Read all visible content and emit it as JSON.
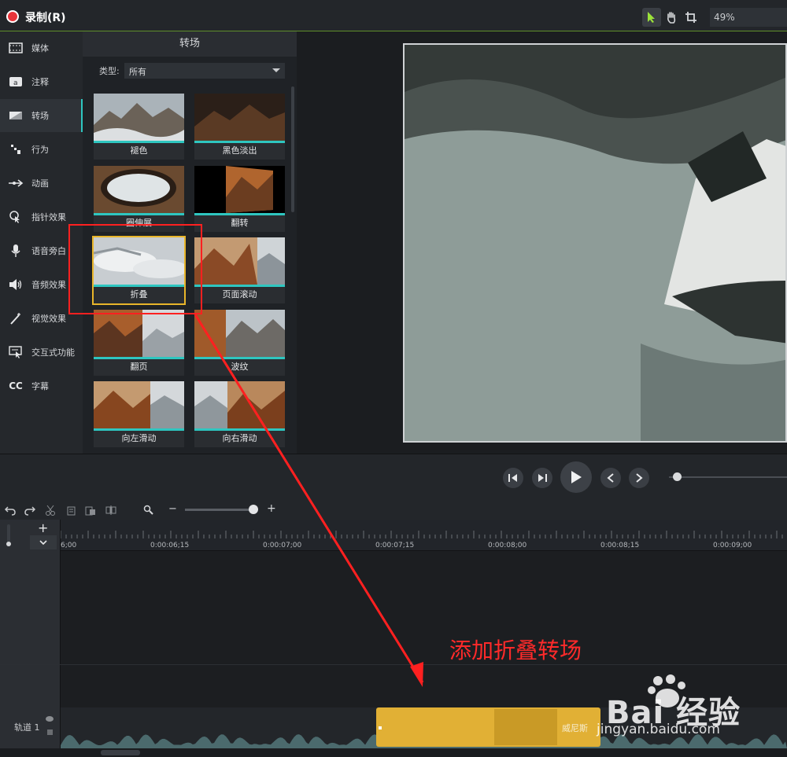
{
  "topbar": {
    "record_label": "录制(R)",
    "zoom_value": "49%"
  },
  "sidebar": {
    "items": [
      {
        "label": "媒体",
        "icon": "film-strip-icon"
      },
      {
        "label": "注释",
        "icon": "annotation-icon"
      },
      {
        "label": "转场",
        "icon": "transition-icon",
        "active": true
      },
      {
        "label": "行为",
        "icon": "behavior-icon"
      },
      {
        "label": "动画",
        "icon": "animation-arrow-icon"
      },
      {
        "label": "指针效果",
        "icon": "cursor-effect-icon"
      },
      {
        "label": "语音旁白",
        "icon": "microphone-icon"
      },
      {
        "label": "音频效果",
        "icon": "speaker-icon"
      },
      {
        "label": "视觉效果",
        "icon": "magic-wand-icon"
      },
      {
        "label": "交互式功能",
        "icon": "interactive-icon"
      },
      {
        "label": "字幕",
        "icon": "cc-icon"
      }
    ]
  },
  "library": {
    "title": "转场",
    "type_label": "类型:",
    "type_value": "所有",
    "tiles": [
      {
        "label": "褪色"
      },
      {
        "label": "黑色淡出"
      },
      {
        "label": "圈伸展"
      },
      {
        "label": "翻转"
      },
      {
        "label": "折叠",
        "selected": true
      },
      {
        "label": "页面滚动"
      },
      {
        "label": "翻页"
      },
      {
        "label": "波纹"
      },
      {
        "label": "向左滑动"
      },
      {
        "label": "向右滑动"
      }
    ]
  },
  "timeline": {
    "ticks": [
      "6;00",
      "0:00:06;15",
      "0:00:07;00",
      "0:00:07;15",
      "0:00:08;00",
      "0:00:08;15",
      "0:00:09;00"
    ],
    "track_label": "轨道 1",
    "clip_name": "威尼斯"
  },
  "annotation": {
    "text": "添加折叠转场"
  },
  "watermark": {
    "brand": "Bai 经验",
    "url": "jingyan.baidu.com"
  },
  "colors": {
    "accent": "#2ec6c0",
    "record": "#e8343a",
    "selection": "#e8b52a",
    "annotation": "#ff2a2a",
    "clip": "#e1b035"
  }
}
